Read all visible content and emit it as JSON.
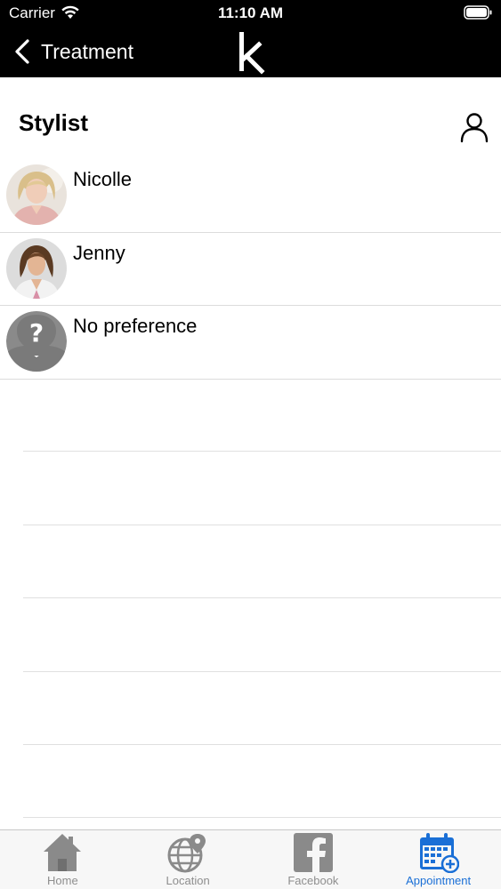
{
  "status_bar": {
    "carrier": "Carrier",
    "time": "11:10 AM"
  },
  "nav": {
    "back_label": "Treatment",
    "logo_icon": "k-logo-icon"
  },
  "header": {
    "title": "Stylist",
    "profile_icon": "person-outline-icon"
  },
  "stylists": [
    {
      "name": "Nicolle",
      "avatar": "photo-woman-blonde"
    },
    {
      "name": "Jenny",
      "avatar": "photo-woman-brunette"
    },
    {
      "name": "No preference",
      "avatar": "question-person-icon"
    }
  ],
  "tabbar": {
    "items": [
      {
        "label": "Home",
        "icon": "house-icon"
      },
      {
        "label": "Location",
        "icon": "globe-pin-icon"
      },
      {
        "label": "Facebook",
        "icon": "facebook-icon"
      },
      {
        "label": "Appointment",
        "icon": "calendar-add-icon"
      }
    ],
    "active_index": 3,
    "active_color": "#1a6fd6",
    "inactive_color": "#8e8e8e"
  }
}
